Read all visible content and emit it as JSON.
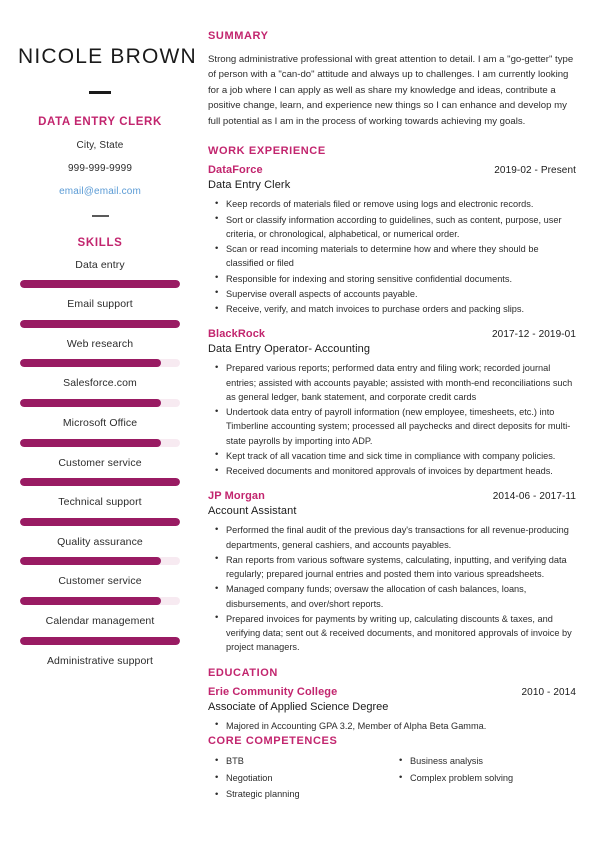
{
  "left": {
    "name": "NICOLE BROWN",
    "job_title": "DATA ENTRY CLERK",
    "location": "City, State",
    "phone": "999-999-9999",
    "email": "email@email.com",
    "skills_heading": "SKILLS",
    "skills": [
      {
        "label": "Data entry",
        "level": 100
      },
      {
        "label": "Email support",
        "level": 100
      },
      {
        "label": "Web research",
        "level": 88
      },
      {
        "label": "Salesforce.com",
        "level": 88
      },
      {
        "label": "Microsoft Office",
        "level": 88
      },
      {
        "label": "Customer service",
        "level": 100
      },
      {
        "label": "Technical support",
        "level": 100
      },
      {
        "label": "Quality assurance",
        "level": 88
      },
      {
        "label": "Customer service",
        "level": 88
      },
      {
        "label": "Calendar management",
        "level": 100
      },
      {
        "label": "Administrative support",
        "level": 0
      }
    ]
  },
  "right": {
    "summary_heading": "SUMMARY",
    "summary_text": "Strong administrative professional with great attention to detail. I am a \"go-getter\" type of person with a \"can-do\" attitude and always up to challenges. I am currently looking for a job where I can apply as well as share my knowledge and ideas, contribute a positive change, learn, and experience new things so I can enhance and develop my full potential as I am in the process of working towards achieving my goals.",
    "work_heading": "WORK EXPERIENCE",
    "experience": [
      {
        "company": "DataForce",
        "dates": "2019-02 - Present",
        "role": "Data Entry Clerk",
        "bullets": [
          "Keep records of materials filed or remove using logs and electronic records.",
          "Sort or classify information according to guidelines, such as content, purpose, user criteria, or chronological, alphabetical, or numerical order.",
          "Scan or read incoming materials to determine how and where they should be classified or filed",
          "Responsible for indexing and storing sensitive confidential documents.",
          "Supervise overall aspects of accounts payable.",
          "Receive, verify, and match invoices to purchase orders and packing slips."
        ]
      },
      {
        "company": "BlackRock",
        "dates": "2017-12 - 2019-01",
        "role": "Data Entry Operator- Accounting",
        "bullets": [
          "Prepared various reports; performed data entry and filing work; recorded journal entries; assisted with accounts payable; assisted with month-end reconciliations such as general ledger, bank statement, and corporate credit cards",
          "Undertook data entry of payroll information (new employee, timesheets, etc.) into Timberline accounting system; processed all paychecks and direct deposits for multi-state payrolls by importing into ADP.",
          "Kept track of all vacation time and sick time in compliance with company policies.",
          "Received documents and monitored approvals of invoices by department heads."
        ]
      },
      {
        "company": "JP Morgan",
        "dates": "2014-06 - 2017-11",
        "role": "Account Assistant",
        "bullets": [
          "Performed the final audit of the previous day's transactions for all revenue-producing departments, general cashiers, and accounts payables.",
          "Ran reports from various software systems, calculating, inputting, and verifying data regularly; prepared journal entries and posted them into various spreadsheets.",
          "Managed company funds; oversaw the allocation of cash balances, loans, disbursements, and over/short reports.",
          "Prepared invoices for payments by writing up, calculating discounts & taxes, and verifying data; sent out & received documents, and monitored approvals of invoice by project managers."
        ]
      }
    ],
    "education_heading": "EDUCATION",
    "education": [
      {
        "school": "Erie Community College",
        "dates": "2010 - 2014",
        "degree": "Associate of Applied Science Degree",
        "bullets": [
          "Majored in Accounting GPA 3.2, Member of Alpha Beta Gamma."
        ]
      }
    ],
    "competences_heading": "CORE COMPETENCES",
    "competences_left": [
      "BTB",
      "Negotiation",
      "Strategic planning"
    ],
    "competences_right": [
      "Business analysis",
      "Complex problem solving"
    ]
  },
  "colors": {
    "accent": "#c2256e",
    "bar_fill": "#991b63",
    "bar_track": "#f7eaf1",
    "link": "#5b9bd5",
    "text": "#2c2c2c"
  }
}
